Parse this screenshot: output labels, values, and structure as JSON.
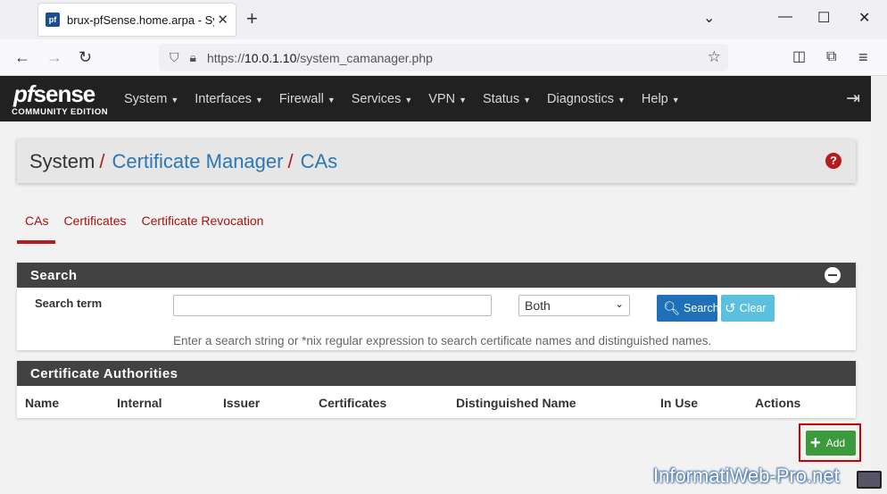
{
  "browser": {
    "tab_title": "brux-pfSense.home.arpa - System",
    "favicon_text": "pf",
    "url_prefix": "https://",
    "url_host": "10.0.1.10",
    "url_path": "/system_camanager.php"
  },
  "pfsense": {
    "logo_main": "pf",
    "logo_main2": "sense",
    "logo_sub": "COMMUNITY EDITION",
    "menu": [
      "System",
      "Interfaces",
      "Firewall",
      "Services",
      "VPN",
      "Status",
      "Diagnostics",
      "Help"
    ]
  },
  "breadcrumb": {
    "part1": "System",
    "part2": "Certificate Manager",
    "part3": "CAs",
    "sep": "/"
  },
  "tabs": [
    {
      "label": "CAs",
      "active": true
    },
    {
      "label": "Certificates",
      "active": false
    },
    {
      "label": "Certificate Revocation",
      "active": false
    }
  ],
  "search_panel": {
    "title": "Search",
    "label": "Search term",
    "input_value": "",
    "select_value": "Both",
    "search_btn": "Search",
    "clear_btn": "Clear",
    "hint": "Enter a search string or *nix regular expression to search certificate names and distinguished names."
  },
  "ca_panel": {
    "title": "Certificate Authorities",
    "columns": [
      "Name",
      "Internal",
      "Issuer",
      "Certificates",
      "Distinguished Name",
      "In Use",
      "Actions"
    ]
  },
  "add_button": "Add",
  "watermark": "InformatiWeb-Pro.net",
  "colors": {
    "brand_red": "#b71c1c",
    "link_blue": "#2d77b3",
    "header_dark": "#424242",
    "add_green": "#3c9a3c"
  }
}
